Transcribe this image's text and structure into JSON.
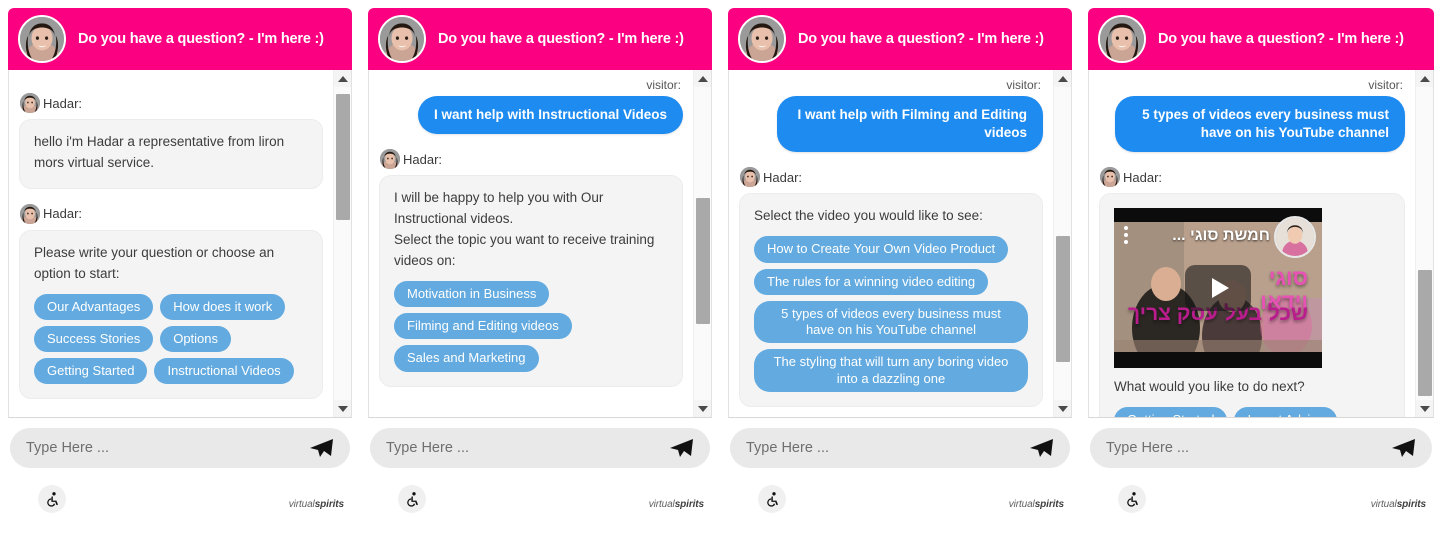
{
  "header": {
    "title": "Do you have a question? - I'm here :)",
    "avatar_icon": "agent-avatar-photo",
    "bg_color": "#FB0080"
  },
  "agent_name": "Hadar:",
  "visitor_label": "visitor:",
  "colors": {
    "header_pink": "#FB0080",
    "visitor_bubble_blue": "#1E8BF0",
    "chip_blue": "#62AADF",
    "agent_bubble_gray": "#F4F4F4"
  },
  "input": {
    "placeholder": "Type Here ...",
    "value": "",
    "send_icon": "send-paper-plane-icon"
  },
  "footer": {
    "accessibility_icon": "wheelchair-accessibility-icon",
    "brand_light": "virtual",
    "brand_bold": "spirits"
  },
  "panels": [
    {
      "id": "panel-1",
      "scroll_thumb_top_pct": 4,
      "scroll_thumb_height_pct": 38,
      "messages": [
        {
          "type": "agent",
          "lines": [
            "hello i'm Hadar a representative from liron",
            "mors virtual service."
          ],
          "chips": []
        },
        {
          "type": "agent",
          "lines": [
            "Please write your question or choose an",
            "option to start:"
          ],
          "chips": [
            "Our Advantages",
            "How does it work",
            "Success Stories",
            "Options",
            "Getting Started",
            "Instructional Videos"
          ]
        }
      ]
    },
    {
      "id": "panel-2",
      "scroll_thumb_top_pct": 33,
      "scroll_thumb_height_pct": 38,
      "messages": [
        {
          "type": "visitor",
          "text": "I want help with Instructional Videos"
        },
        {
          "type": "agent",
          "lines": [
            "I will be happy to help you with Our",
            "Instructional videos.",
            "Select the topic you want to receive training",
            "videos on:"
          ],
          "chips": [
            "Motivation in Business",
            "Filming and Editing videos",
            "Sales and Marketing"
          ]
        }
      ]
    },
    {
      "id": "panel-3",
      "scroll_thumb_top_pct": 48,
      "scroll_thumb_height_pct": 38,
      "messages": [
        {
          "type": "visitor",
          "text": "I want help with Filming and Editing videos"
        },
        {
          "type": "agent",
          "lines": [
            "Select the video you would like to see:"
          ],
          "chips": [
            "How to Create Your Own Video Product",
            "The rules for a winning video editing",
            "5 types of videos every business must have on his YouTube channel",
            "The styling that will turn any boring video into a dazzling one"
          ]
        }
      ]
    },
    {
      "id": "panel-4",
      "scroll_thumb_top_pct": 58,
      "scroll_thumb_height_pct": 38,
      "messages": [
        {
          "type": "visitor",
          "text": "5 types of videos every business must have on his YouTube channel"
        },
        {
          "type": "agent-video",
          "video": {
            "overlay_title": "חמשת סוגי ...",
            "overlay_line2": "סוגי\nוידאו",
            "overlay_line3": "שכל בעל עסק צריך",
            "play_icon": "play-button-icon",
            "menu_icon": "kebab-menu-icon"
          },
          "followup": "What would you like to do next?",
          "chips": [
            "Getting Started",
            "I want Advice"
          ]
        }
      ]
    }
  ]
}
